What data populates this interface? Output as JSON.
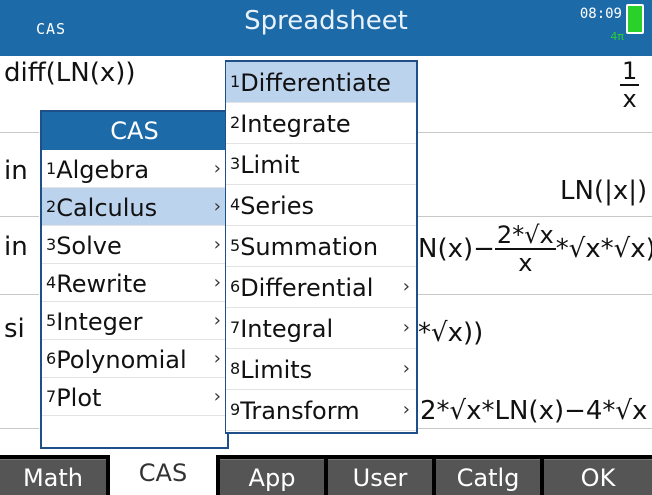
{
  "status_bar": {
    "mode": "CAS",
    "title": "Spreadsheet",
    "time": "08:09",
    "signal": "4π"
  },
  "history": {
    "row1_input": "diff(LN(x))",
    "row1_result_num": "1",
    "row1_result_den": "x",
    "row2_prefix": "in",
    "row2_result": "LN(|x|)",
    "row3_prefix": "in",
    "row3_result_a": "N(x)−",
    "row3_result_num": "2*√x",
    "row3_result_den": "x",
    "row3_result_b": "*√x*√x)",
    "row4_prefix": "si",
    "row4_result_a": "*√x))",
    "row5_result": "2*√x*LN(x)−4*√x"
  },
  "menu_left": {
    "header": "CAS",
    "items": [
      {
        "num": "1",
        "label": "Algebra"
      },
      {
        "num": "2",
        "label": "Calculus"
      },
      {
        "num": "3",
        "label": "Solve"
      },
      {
        "num": "4",
        "label": "Rewrite"
      },
      {
        "num": "5",
        "label": "Integer"
      },
      {
        "num": "6",
        "label": "Polynomial"
      },
      {
        "num": "7",
        "label": "Plot"
      }
    ]
  },
  "menu_right": {
    "items": [
      {
        "num": "1",
        "label": "Differentiate"
      },
      {
        "num": "2",
        "label": "Integrate"
      },
      {
        "num": "3",
        "label": "Limit"
      },
      {
        "num": "4",
        "label": "Series"
      },
      {
        "num": "5",
        "label": "Summation"
      },
      {
        "num": "6",
        "label": "Differential"
      },
      {
        "num": "7",
        "label": "Integral"
      },
      {
        "num": "8",
        "label": "Limits"
      },
      {
        "num": "9",
        "label": "Transform"
      }
    ]
  },
  "softkeys": {
    "math": "Math",
    "cas": "CAS",
    "app": "App",
    "user": "User",
    "catlg": "Catlg",
    "ok": "OK"
  },
  "arrow_glyph": "›"
}
